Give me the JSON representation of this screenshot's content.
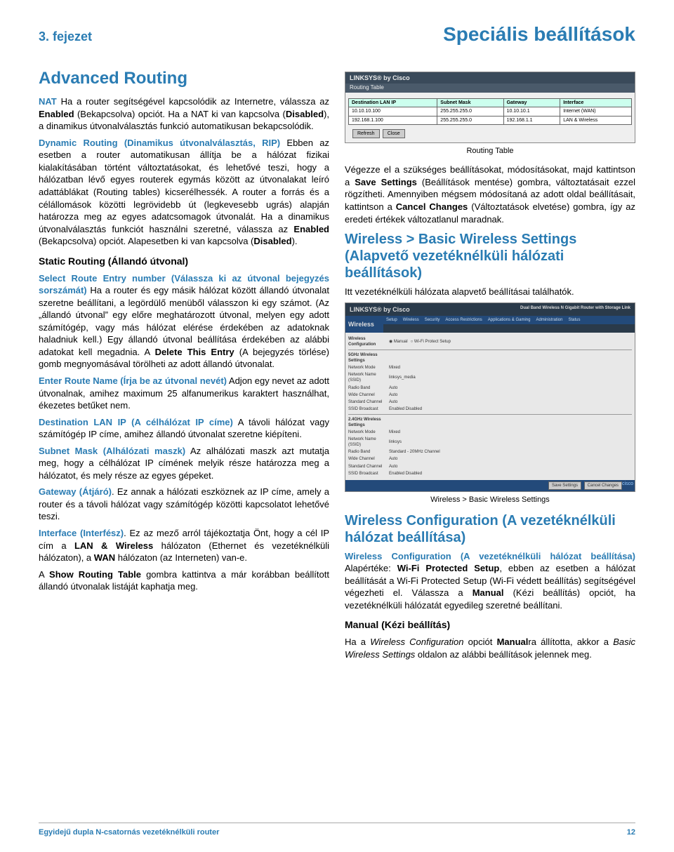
{
  "header": {
    "chapter": "3. fejezet",
    "section": "Speciális beállítások"
  },
  "col1": {
    "h1": "Advanced Routing",
    "p_nat": {
      "lead": "NAT",
      "text": " Ha a router segítségével kapcsolódik az Internetre, válassza az ",
      "b1": "Enabled",
      "mid": " (Bekapcsolva) opciót. Ha a NAT ki van kapcsolva (",
      "b2": "Disabled",
      "end": "), a dinamikus útvonalválasztás funkció automatikusan bekapcsolódik."
    },
    "p_dyn": {
      "lead": "Dynamic Routing (Dinamikus útvonalválasztás, RIP)",
      "text": " Ebben az esetben a router automatikusan állítja be a hálózat fizikai kialakításában történt változtatásokat, és lehetővé teszi, hogy a hálózatban lévő egyes routerek egymás között az útvonalakat leíró adattáblákat (Routing tables) kicserélhessék. A router a forrás és a célállomások közötti legrövidebb út (legkevesebb ugrás) alapján határozza meg az egyes adatcsomagok útvonalát. Ha a dinamikus útvonalválasztás funkciót használni szeretné, válassza az ",
      "b1": "Enabled",
      "mid": " (Bekapcsolva) opciót. Alapesetben ki van kapcsolva (",
      "b2": "Disabled",
      "end": ")."
    },
    "h3a": "Static Routing (Állandó útvonal)",
    "p_sel": {
      "lead": "Select Route Entry number (Válassza ki az útvonal bejegyzés sorszámát)",
      "text": " Ha a router és egy másik hálózat között állandó útvonalat szeretne beállítani, a legördülő menüből válasszon ki egy számot. (Az „állandó útvonal” egy előre meghatározott útvonal, melyen egy adott számítógép, vagy más hálózat elérése érdekében az adatoknak haladniuk kell.) Egy állandó útvonal beállítása érdekében az alábbi adatokat kell megadnia. A ",
      "b1": "Delete This Entry",
      "end": " (A bejegyzés törlése) gomb megnyomásával törölheti az adott állandó útvonalat."
    },
    "p_ent": {
      "lead": "Enter Route Name (Írja be az útvonal nevét)",
      "text": " Adjon egy nevet az adott útvonalnak, amihez maximum 25 alfanumerikus karaktert használhat, ékezetes betűket nem."
    },
    "p_dest": {
      "lead": "Destination LAN IP (A célhálózat IP címe)",
      "text": " A távoli hálózat vagy számítógép IP címe, amihez állandó útvonalat szeretne kiépíteni."
    },
    "p_sub": {
      "lead": "Subnet Mask (Alhálózati maszk)",
      "text": " Az alhálózati maszk azt mutatja meg, hogy a célhálózat IP címének melyik része határozza meg a hálózatot, és mely része az egyes gépeket."
    },
    "p_gw": {
      "lead": "Gateway (Átjáró)",
      "text": ". Ez annak a hálózati eszköznek az IP címe, amely a router és a távoli hálózat vagy számítógép közötti kapcsolatot lehetővé teszi."
    },
    "p_if": {
      "lead": "Interface (Interfész)",
      "text": ". Ez az mező arról tájékoztatja Önt, hogy a cél IP cím a ",
      "b1": "LAN & Wireless",
      "mid": " hálózaton (Ethernet és vezetéknélküli hálózaton), a ",
      "b2": "WAN",
      "end": " hálózaton (az Interneten) van-e."
    },
    "p_show": {
      "pre": "A ",
      "b1": "Show Routing Table",
      "end": " gombra kattintva a már korábban beállított állandó útvonalak listáját kaphatja meg."
    }
  },
  "col2": {
    "fig1": {
      "brand": "LINKSYS® by Cisco",
      "tab": "Routing Table",
      "headers": [
        "Destination LAN IP",
        "Subnet Mask",
        "Gateway",
        "Interface"
      ],
      "rows": [
        [
          "10.10.10.100",
          "255.255.255.0",
          "10.10.10.1",
          "Internet (WAN)"
        ],
        [
          "192.168.1.100",
          "255.255.255.0",
          "192.168.1.1",
          "LAN & Wireless"
        ]
      ],
      "btns": [
        "Refresh",
        "Close"
      ],
      "caption": "Routing Table"
    },
    "p_save": {
      "text": "Végezze el a szükséges beállításokat, módosításokat, majd kattintson a ",
      "b1": "Save Settings",
      "mid1": " (Beállítások mentése) gombra, változtatásait ezzel rögzítheti. Amennyiben mégsem módosítaná az adott oldal beállításait, kattintson a ",
      "b2": "Cancel Changes",
      "end": " (Változtatások elvetése) gombra, így az eredeti értékek változatlanul maradnak."
    },
    "h2a": "Wireless > Basic Wireless Settings (Alapvető vezetéknélküli hálózati beállítások)",
    "p_intro": "Itt vezetéknélküli hálózata alapvető beállításai találhatók.",
    "fig2": {
      "brand": "LINKSYS® by Cisco",
      "title": "Dual Band Wireless N Gigabit Router with Storage Link",
      "side": "Wireless",
      "tabs": [
        "Setup",
        "Wireless",
        "Security",
        "Access Restrictions",
        "Applications & Gaming",
        "Administration",
        "Status"
      ],
      "sub": "Wireless Configuration",
      "radio": [
        "Manual",
        "Wi-Fi Protect Setup"
      ],
      "group1": "5GHz Wireless Settings",
      "group2": "2.4GHz Wireless Settings",
      "rows1": [
        [
          "Network Mode",
          "Mixed"
        ],
        [
          "Network Name (SSID)",
          "linksys_media"
        ],
        [
          "Radio Band",
          "Auto"
        ],
        [
          "Wide Channel",
          "Auto"
        ],
        [
          "Standard Channel",
          "Auto"
        ],
        [
          "SSID Broadcast",
          "Enabled  Disabled"
        ]
      ],
      "rows2": [
        [
          "Network Mode",
          "Mixed"
        ],
        [
          "Network Name (SSID)",
          "linksys"
        ],
        [
          "Radio Band",
          "Standard - 20MHz Channel"
        ],
        [
          "Wide Channel",
          "Auto"
        ],
        [
          "Standard Channel",
          "Auto"
        ],
        [
          "SSID Broadcast",
          "Enabled  Disabled"
        ]
      ],
      "save": [
        "Save Settings",
        "Cancel Changes"
      ],
      "cisco": "cisco",
      "caption": "Wireless > Basic Wireless Settings"
    },
    "h2b": "Wireless Configuration (A vezetéknélküli hálózat beállítása)",
    "p_wc": {
      "lead": "Wireless Configuration (A vezetéknélküli hálózat beállítása)",
      "text": " Alapértéke: ",
      "b1": "Wi-Fi Protected Setup",
      "mid": ", ebben az esetben a hálózat beállítását a Wi-Fi Protected Setup (Wi-Fi védett beállítás) segítségével végezheti el. Válassza a ",
      "b2": "Manual",
      "end": " (Kézi beállítás) opciót, ha vezetéknélküli hálózatát egyedileg szeretné beállítani."
    },
    "h3b": "Manual (Kézi beállítás)",
    "p_man": {
      "pre": "Ha a ",
      "i1": "Wireless Configuration",
      "mid1": " opciót ",
      "b1": "Manual",
      "mid2": "ra állította, akkor a ",
      "i2": "Basic Wireless Settings",
      "end": " oldalon az alábbi beállítások jelennek meg."
    }
  },
  "footer": {
    "left": "Egyidejű dupla N-csatornás vezetéknélküli router",
    "page": "12"
  }
}
